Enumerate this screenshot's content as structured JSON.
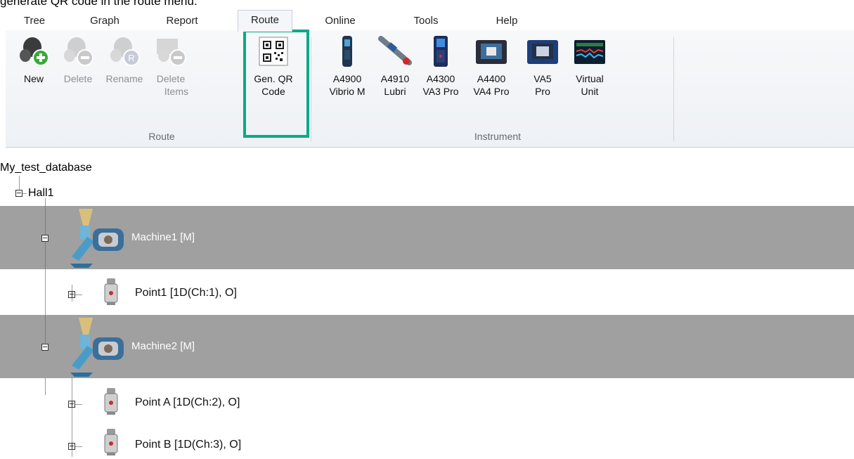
{
  "caption": "generate QR code in the route menu.",
  "tabs": [
    {
      "label": "Tree"
    },
    {
      "label": "Graph"
    },
    {
      "label": "Report"
    },
    {
      "label": "Route"
    },
    {
      "label": "Online"
    },
    {
      "label": "Tools"
    },
    {
      "label": "Help"
    }
  ],
  "active_tab": "Route",
  "ribbon": {
    "route_group": {
      "label": "Route",
      "buttons": [
        {
          "line1": "New",
          "line2": "",
          "icon": "new-icon",
          "enabled": true
        },
        {
          "line1": "Delete",
          "line2": "",
          "icon": "delete-icon",
          "enabled": false
        },
        {
          "line1": "Rename",
          "line2": "",
          "icon": "rename-icon",
          "enabled": false
        },
        {
          "line1": "Delete",
          "line2": "Items",
          "icon": "delete-items-icon",
          "enabled": false
        },
        {
          "line1": "Gen. QR",
          "line2": "Code",
          "icon": "qr-code-icon",
          "enabled": true
        }
      ]
    },
    "instrument_group": {
      "label": "Instrument",
      "buttons": [
        {
          "line1": "A4900",
          "line2": "Vibrio M",
          "icon": "a4900-device-icon"
        },
        {
          "line1": "A4910",
          "line2": "Lubri",
          "icon": "a4910-device-icon"
        },
        {
          "line1": "A4300",
          "line2": "VA3 Pro",
          "icon": "a4300-device-icon"
        },
        {
          "line1": "A4400",
          "line2": "VA4 Pro",
          "icon": "a4400-device-icon"
        },
        {
          "line1": "VA5",
          "line2": "Pro",
          "icon": "va5-device-icon"
        },
        {
          "line1": "Virtual",
          "line2": "Unit",
          "icon": "virtual-unit-icon"
        }
      ]
    },
    "highlight_color": "#0aaa87"
  },
  "tree": {
    "root": "My_test_database",
    "hall": "Hall1",
    "machines": [
      {
        "label": "Machine1 [M]",
        "points": [
          "Point1 [1D(Ch:1), O]"
        ]
      },
      {
        "label": "Machine2 [M]",
        "points": [
          "Point A [1D(Ch:2), O]",
          "Point B [1D(Ch:3), O]"
        ]
      }
    ],
    "machine_row_color": "#a0a0a0"
  }
}
